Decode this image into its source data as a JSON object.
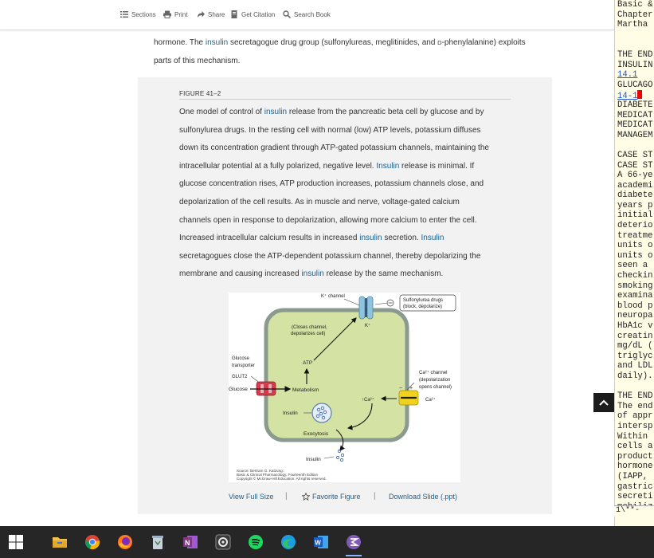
{
  "toolbar": {
    "sections": "Sections",
    "print": "Print",
    "share": "Share",
    "get_citation": "Get Citation",
    "search_book": "Search Book"
  },
  "body_text": {
    "line1_a": "hormone. The ",
    "line1_link": "insulin",
    "line1_b": " secretagogue drug group (sulfonylureas, meglitinides, and ",
    "line1_small": "D",
    "line1_c": "-phenylalanine) exploits",
    "line2": "parts of this mechanism."
  },
  "figure": {
    "label": "FIGURE 41–2",
    "caption_lines": [
      [
        "One model of control of ",
        "insulin",
        " release from the pancreatic beta cell by glucose and by"
      ],
      [
        "sulfonylurea drugs. In the resting cell with normal (low) ATP levels, potassium diffuses",
        "",
        ""
      ],
      [
        "down its concentration gradient through ATP-gated potassium channels, maintaining the",
        "",
        ""
      ],
      [
        "intracellular potential at a fully polarized, negative level. ",
        "Insulin",
        " release is minimal. If"
      ],
      [
        "glucose concentration rises, ATP production increases, potassium channels close, and",
        "",
        ""
      ],
      [
        "depolarization of the cell results. As in muscle and nerve, voltage-gated calcium",
        "",
        ""
      ],
      [
        "channels open in response to depolarization, allowing more calcium to enter the cell.",
        "",
        ""
      ],
      [
        "Increased intracellular calcium results in increased ",
        "insulin",
        " secretion. "
      ],
      [
        "secretagogues close the ATP-dependent potassium channel, thereby depolarizing the",
        "",
        ""
      ],
      [
        "membrane and causing increased ",
        "insulin",
        " release by the same mechanism."
      ]
    ],
    "caption_line8_tail_link": "Insulin",
    "diagram": {
      "k_channel": "K⁺ channel",
      "sulfonylurea_1": "Sulfonylurea drugs",
      "sulfonylurea_2": "(block, depolarize)",
      "k_plus": "K⁺",
      "closes_1": "(Closes channel,",
      "closes_2": "depolarizes cell)",
      "atp": "ATP",
      "glucose_transporter_1": "Glucose",
      "glucose_transporter_2": "transporter",
      "glut2": "GLUT2",
      "glucose": "Glucose",
      "metabolism": "Metabolism",
      "ca_channel_1": "Ca²⁺ channel",
      "ca_channel_2": "(depolarization",
      "ca_channel_3": "opens channel)",
      "ca_in": "↑Ca²⁺",
      "ca_out": "Ca²⁺",
      "minus": "−",
      "plus": "+",
      "insulin_granule": "Insulin",
      "exocytosis": "Exocytosis",
      "insulin_out": "Insulin",
      "source_1": "Source: Bertram G. Katzung:",
      "source_2": "Basic & Clinical Pharmacology, Fourteenth Edition",
      "source_3": "Copyright © McGraw-Hill Education. All rights reserved."
    },
    "view_full_size": "View Full Size",
    "favorite_figure": "Favorite Figure",
    "download_slide": "Download Slide (.ppt)",
    "separator": "|"
  },
  "side_panel": {
    "lines": [
      {
        "text": "Basic &",
        "link": false
      },
      {
        "text": "Chapter",
        "link": false
      },
      {
        "text": "Martha",
        "link": false
      },
      {
        "text": "",
        "link": false
      },
      {
        "text": "",
        "link": false
      },
      {
        "text": "THE END",
        "link": false
      },
      {
        "text": "INSULIN",
        "link": false
      },
      {
        "text": "14.1",
        "link": true
      },
      {
        "text": "GLUCAGO",
        "link": false
      },
      {
        "text": "14-1",
        "link": true
      },
      {
        "text": "DIABETE",
        "link": false
      },
      {
        "text": "MEDICAT",
        "link": false
      },
      {
        "text": "MEDICAT",
        "link": false
      },
      {
        "text": "MANAGEM",
        "link": false
      },
      {
        "text": "",
        "link": false
      },
      {
        "text": "CASE ST",
        "link": false
      },
      {
        "text": "CASE ST",
        "link": false
      },
      {
        "text": "A 66-ye",
        "link": false
      },
      {
        "text": "academi",
        "link": false
      },
      {
        "text": "diabete",
        "link": false
      },
      {
        "text": "years p",
        "link": false
      },
      {
        "text": "initial",
        "link": false
      },
      {
        "text": "deterio",
        "link": false
      },
      {
        "text": "treatme",
        "link": false
      },
      {
        "text": "units o",
        "link": false
      },
      {
        "text": "units o",
        "link": false
      },
      {
        "text": "seen a",
        "link": false
      },
      {
        "text": "checkin",
        "link": false
      },
      {
        "text": "smoking",
        "link": false
      },
      {
        "text": "examina",
        "link": false
      },
      {
        "text": "blood p",
        "link": false
      },
      {
        "text": "neuropa",
        "link": false
      },
      {
        "text": "HbA1c v",
        "link": false
      },
      {
        "text": "creatin",
        "link": false
      },
      {
        "text": "mg/dL (",
        "link": false
      },
      {
        "text": "triglyc",
        "link": false
      },
      {
        "text": "and LDL",
        "link": false
      },
      {
        "text": "daily).",
        "link": false
      },
      {
        "text": "",
        "link": false
      },
      {
        "text": "THE END",
        "link": false
      },
      {
        "text": "The end",
        "link": false
      },
      {
        "text": "of appr",
        "link": false
      },
      {
        "text": "intersp",
        "link": false
      },
      {
        "text": "Within",
        "link": false
      },
      {
        "text": "cells a",
        "link": false
      },
      {
        "text": "product",
        "link": false
      },
      {
        "text": "hormone",
        "link": false
      },
      {
        "text": "(IAPP,",
        "link": false
      },
      {
        "text": "gastric",
        "link": false
      },
      {
        "text": "secreti",
        "link": false
      },
      {
        "text": "mobiliz",
        "link": false
      }
    ],
    "modeline": "1\\**-"
  },
  "taskbar": {
    "apps": [
      "windows-start",
      "file-explorer",
      "chrome",
      "firefox",
      "recycle-bin",
      "onenote",
      "settings-app",
      "spotify",
      "edge",
      "word",
      "emacs"
    ]
  },
  "colors": {
    "link": "#1a5f8f",
    "cell_fill": "#d4e2a4",
    "cell_stroke": "#8a9a8f",
    "taskbar": "#262626",
    "side_bg": "#fffde6"
  }
}
